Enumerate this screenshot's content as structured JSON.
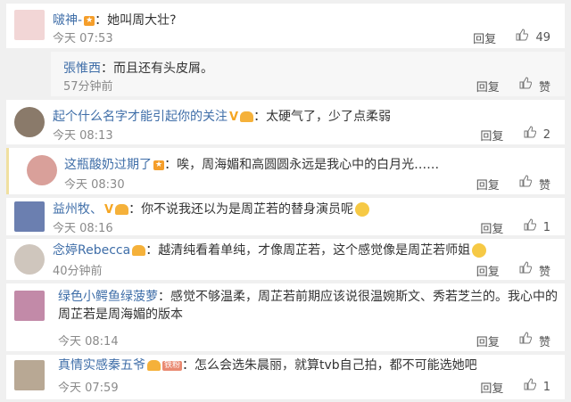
{
  "comments": [
    {
      "user": "啵神-",
      "text": "她叫周大壮?",
      "time": "今天 07:53",
      "reply": "回复",
      "likes": "49"
    },
    {
      "user": "張惟西",
      "text": "而且还有头皮屑。",
      "time": "57分钟前",
      "reply": "回复",
      "likes": "赞"
    },
    {
      "user": "起个什么名字才能引起你的关注",
      "text": "太硬气了，少了点柔弱",
      "time": "今天 08:13",
      "reply": "回复",
      "likes": "2"
    },
    {
      "user": "这瓶酸奶过期了",
      "text": "唉，周海媚和高圆圆永远是我心中的白月光……",
      "time": "今天 08:30",
      "reply": "回复",
      "likes": "赞"
    },
    {
      "user": "益州牧、",
      "text": "你不说我还以为是周芷若的替身演员呢",
      "time": "今天 08:16",
      "reply": "回复",
      "likes": "1"
    },
    {
      "user": "念婷Rebecca",
      "text": "越清纯看着单纯，才像周芷若，这个感觉像是周芷若师姐",
      "time": "40分钟前",
      "reply": "回复",
      "likes": "赞"
    },
    {
      "user": "绿色小鳄鱼绿菠萝",
      "text": "感觉不够温柔，周芷若前期应该说很温婉斯文、秀若芝兰的。我心中的周芷若是周海媚的版本",
      "time": "今天 08:14",
      "reply": "回复",
      "likes": "赞"
    },
    {
      "user": "真情实感秦五爷",
      "badge": "铁粉",
      "text": "怎么会选朱晨丽，就算tvb自己拍，都不可能选她吧",
      "time": "今天 07:59",
      "reply": "回复",
      "likes": "1"
    }
  ],
  "colors": {
    "user": "#3f6ea8",
    "meta": "#8a8a8a",
    "background": "#f0f0f0"
  }
}
